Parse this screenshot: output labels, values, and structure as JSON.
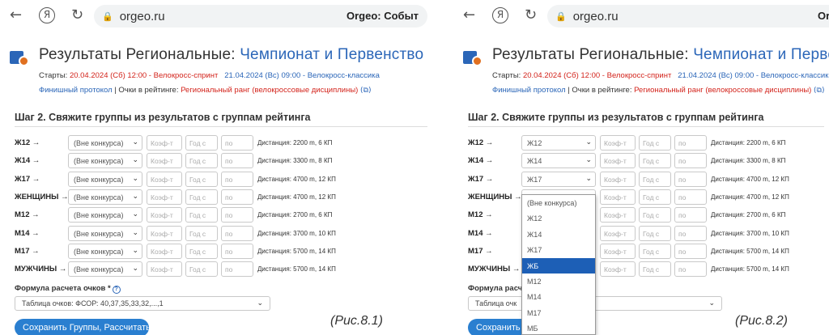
{
  "browser": {
    "url": "orgeo.ru",
    "tab_title_p1": "Orgeo: Событ",
    "tab_title_p2": "Org",
    "back_glyph": "←",
    "ya_glyph": "Я",
    "reload_glyph": "↻",
    "lock_glyph": "🔒"
  },
  "header": {
    "title_prefix": "Результаты Региональные:",
    "title_accent": "Чемпионат и Первенство",
    "title_accent_p2": "Чемпионат и Первенс",
    "starts_label": "Старты:",
    "start1": "20.04.2024 (Сб) 12:00 - Велокросс-спринт",
    "start2": "21.04.2024 (Вс) 09:00 - Велокросс-классика",
    "finish_link": "Финишный протокол",
    "separator": "|",
    "rating_label": "Очки в рейтинге:",
    "rating_link": "Региональный ранг (велокроссовые дисциплины)",
    "ext_glyph": "⧉"
  },
  "step": {
    "title": "Шаг 2. Свяжите группы из результатов с группам рейтинга"
  },
  "row_labels": [
    "Ж12 →",
    "Ж14 →",
    "Ж17 →",
    "ЖЕНЩИНЫ →",
    "М12 →",
    "М14 →",
    "М17 →",
    "МУЖЧИНЫ →"
  ],
  "row_dist": [
    "Дистанция: 2200 m, 6 КП",
    "Дистанция: 3300 m, 8 КП",
    "Дистанция: 4700 m, 12 КП",
    "Дистанция: 4700 m, 12 КП",
    "Дистанция: 2700 m, 6 КП",
    "Дистанция: 3700 m, 10 КП",
    "Дистанция: 5700 m, 14 КП",
    "Дистанция: 5700 m, 14 КП"
  ],
  "p1_selects": [
    "(Вне конкурса)",
    "(Вне конкурса)",
    "(Вне конкурса)",
    "(Вне конкурса)",
    "(Вне конкурса)",
    "(Вне конкурса)",
    "(Вне конкурса)",
    "(Вне конкурса)"
  ],
  "p2_selects": [
    "Ж12",
    "Ж14",
    "Ж17",
    "(Вне конкурса)",
    "",
    "",
    "",
    ""
  ],
  "placeholders": {
    "coef": "Коэф-т",
    "year_from": "Год с",
    "year_to": "по"
  },
  "chevron_glyph": "⌄",
  "formula": {
    "label": "Формула расчета очков *",
    "label_p2": "Формула расче",
    "help_glyph": "?",
    "value": "Таблица очков: ФСОР: 40,37,35,33,32,...,1",
    "value_p2": "Таблица очк",
    "value_p2_tail": "32,...,1"
  },
  "save_button": {
    "label": "Сохранить Группы, Рассчитать",
    "label_p2": "Сохранить Г"
  },
  "captions": {
    "p1": "(Рис.8.1)",
    "p2": "(Рис.8.2)"
  },
  "dropdown": {
    "options": [
      "(Вне конкурса)",
      "Ж12",
      "Ж14",
      "Ж17",
      "ЖБ",
      "М12",
      "М14",
      "М17",
      "МБ"
    ],
    "selected_index": 4
  },
  "colors": {
    "accent": "#2b66b8",
    "red": "#d3241c",
    "button": "#2a7fd0",
    "selected": "#1d5fb6"
  }
}
